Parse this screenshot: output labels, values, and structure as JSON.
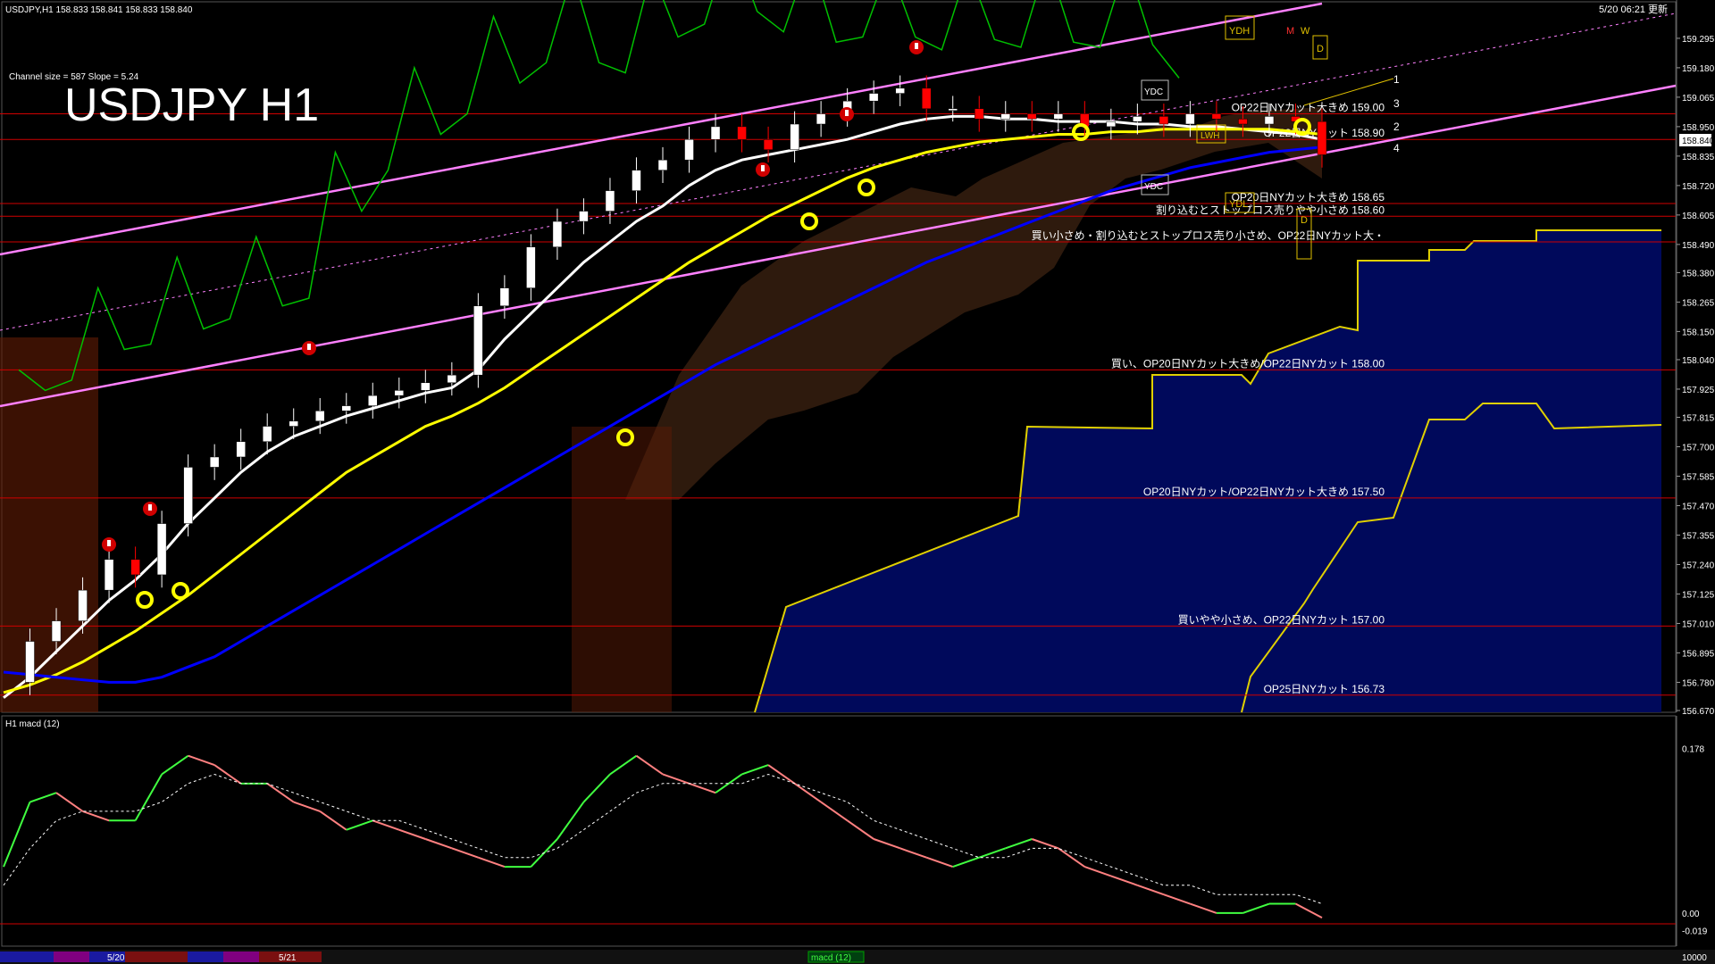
{
  "header": {
    "symbol_info": "USDJPY,H1  158.833 158.841 158.833 158.840",
    "datetime": "5/20 06:21 更新",
    "channel_info": "Channel size = 587 Slope = 5.24",
    "title": "USDJPY H1"
  },
  "colors": {
    "background": "#000000",
    "bull_candle": "#ffffff",
    "bear_candle": "#ff0000",
    "sma_short": "#ffffff",
    "sma_mid": "#ffff00",
    "sma_long": "#0000ff",
    "chikou": "#00c000",
    "channel": "#ff80ff",
    "level_line": "#d00000",
    "kumo_bull": "#ff8040",
    "kumo_bear": "#0000c0",
    "macd_up": "#40ff40",
    "macd_down": "#ff8080",
    "signal": "#ffffff"
  },
  "chart_data": [
    {
      "type": "line",
      "title": "USDJPY H1",
      "price_axis_ticks": [
        "159.295",
        "159.180",
        "159.065",
        "158.950",
        "158.835",
        "158.720",
        "158.605",
        "158.490",
        "158.380",
        "158.265",
        "158.150",
        "158.040",
        "157.925",
        "157.815",
        "157.700",
        "157.585",
        "157.470",
        "157.355",
        "157.240",
        "157.125",
        "157.010",
        "156.895",
        "156.780",
        "156.670"
      ],
      "ylim": [
        156.67,
        159.34
      ],
      "current_price": "158.840",
      "x": [
        0,
        4,
        8,
        12,
        16,
        20,
        24,
        28,
        32,
        36,
        40,
        44,
        48,
        52,
        56,
        60,
        64,
        68,
        72,
        76,
        80,
        84,
        88,
        92,
        96,
        100,
        104,
        108,
        112,
        116,
        120,
        124,
        128,
        132,
        136,
        140,
        144,
        148,
        152,
        156,
        160,
        164,
        168,
        172,
        176,
        180,
        184,
        188,
        192,
        196,
        200
      ],
      "series": [
        {
          "name": "close",
          "values": [
            156.78,
            156.94,
            157.02,
            157.14,
            157.26,
            157.2,
            157.4,
            157.62,
            157.66,
            157.72,
            157.78,
            157.8,
            157.84,
            157.86,
            157.9,
            157.92,
            157.95,
            157.98,
            158.25,
            158.32,
            158.48,
            158.58,
            158.62,
            158.7,
            158.78,
            158.82,
            158.9,
            158.95,
            158.9,
            158.86,
            158.96,
            159.0,
            159.05,
            159.08,
            159.1,
            159.02,
            159.02,
            158.98,
            159.0,
            158.98,
            159.0,
            158.95,
            158.97,
            158.99,
            158.96,
            159.0,
            158.98,
            158.96,
            158.99,
            158.97,
            158.84
          ]
        },
        {
          "name": "sma_short",
          "values": [
            156.72,
            156.8,
            156.9,
            157.0,
            157.1,
            157.18,
            157.28,
            157.4,
            157.5,
            157.6,
            157.68,
            157.74,
            157.78,
            157.82,
            157.85,
            157.88,
            157.91,
            157.93,
            158.0,
            158.12,
            158.22,
            158.32,
            158.42,
            158.5,
            158.58,
            158.64,
            158.72,
            158.78,
            158.82,
            158.84,
            158.86,
            158.88,
            158.9,
            158.93,
            158.96,
            158.98,
            158.99,
            158.99,
            158.98,
            158.98,
            158.97,
            158.97,
            158.97,
            158.96,
            158.96,
            158.95,
            158.95,
            158.94,
            158.93,
            158.92,
            158.9
          ]
        },
        {
          "name": "sma_mid",
          "values": [
            156.74,
            156.77,
            156.81,
            156.86,
            156.92,
            156.98,
            157.05,
            157.12,
            157.2,
            157.28,
            157.36,
            157.44,
            157.52,
            157.6,
            157.66,
            157.72,
            157.78,
            157.82,
            157.87,
            157.93,
            158.0,
            158.07,
            158.14,
            158.21,
            158.28,
            158.35,
            158.42,
            158.48,
            158.54,
            158.6,
            158.65,
            158.7,
            158.75,
            158.79,
            158.82,
            158.85,
            158.87,
            158.89,
            158.9,
            158.91,
            158.92,
            158.92,
            158.93,
            158.93,
            158.94,
            158.94,
            158.94,
            158.94,
            158.94,
            158.93,
            158.92
          ]
        },
        {
          "name": "sma_long",
          "values": [
            156.82,
            156.81,
            156.8,
            156.79,
            156.78,
            156.78,
            156.8,
            156.84,
            156.88,
            156.94,
            157.0,
            157.06,
            157.12,
            157.18,
            157.24,
            157.3,
            157.36,
            157.42,
            157.48,
            157.54,
            157.6,
            157.66,
            157.72,
            157.78,
            157.84,
            157.9,
            157.96,
            158.02,
            158.07,
            158.12,
            158.17,
            158.22,
            158.27,
            158.32,
            158.37,
            158.42,
            158.46,
            158.5,
            158.54,
            158.58,
            158.62,
            158.66,
            158.7,
            158.73,
            158.76,
            158.79,
            158.81,
            158.83,
            158.85,
            158.86,
            158.87
          ]
        }
      ]
    },
    {
      "type": "line",
      "title": "H1  macd (12)",
      "axis_ticks": [
        "0.178",
        "0.00",
        "-0.019"
      ],
      "ylim": [
        -0.03,
        0.19
      ],
      "x": [
        0,
        4,
        8,
        12,
        16,
        20,
        24,
        28,
        32,
        36,
        40,
        44,
        48,
        52,
        56,
        60,
        64,
        68,
        72,
        76,
        80,
        84,
        88,
        92,
        96,
        100,
        104,
        108,
        112,
        116,
        120,
        124,
        128,
        132,
        136,
        140,
        144,
        148,
        152,
        156,
        160,
        164,
        168,
        172,
        176,
        180,
        184,
        188,
        192,
        196,
        200
      ],
      "series": [
        {
          "name": "macd",
          "values": [
            0.05,
            0.12,
            0.13,
            0.11,
            0.1,
            0.1,
            0.15,
            0.17,
            0.16,
            0.14,
            0.14,
            0.12,
            0.11,
            0.09,
            0.1,
            0.09,
            0.08,
            0.07,
            0.06,
            0.05,
            0.05,
            0.08,
            0.12,
            0.15,
            0.17,
            0.15,
            0.14,
            0.13,
            0.15,
            0.16,
            0.14,
            0.12,
            0.1,
            0.08,
            0.07,
            0.06,
            0.05,
            0.06,
            0.07,
            0.08,
            0.07,
            0.05,
            0.04,
            0.03,
            0.02,
            0.01,
            0.0,
            0.0,
            0.01,
            0.01,
            -0.005
          ]
        },
        {
          "name": "signal",
          "values": [
            0.03,
            0.07,
            0.1,
            0.11,
            0.11,
            0.11,
            0.12,
            0.14,
            0.15,
            0.14,
            0.14,
            0.13,
            0.12,
            0.11,
            0.1,
            0.1,
            0.09,
            0.08,
            0.07,
            0.06,
            0.06,
            0.07,
            0.09,
            0.11,
            0.13,
            0.14,
            0.14,
            0.14,
            0.14,
            0.15,
            0.14,
            0.13,
            0.12,
            0.1,
            0.09,
            0.08,
            0.07,
            0.06,
            0.06,
            0.07,
            0.07,
            0.06,
            0.05,
            0.04,
            0.03,
            0.03,
            0.02,
            0.02,
            0.02,
            0.02,
            0.01
          ]
        }
      ]
    }
  ],
  "levels": [
    {
      "label": "OP22日NYカット大きめ 159.00",
      "price": 159.0
    },
    {
      "label": "OP22日NYカット 158.90",
      "price": 158.9
    },
    {
      "label": "OP20日NYカット大きめ 158.65",
      "price": 158.65
    },
    {
      "label": "割り込むとストップロス売りやや小さめ 158.60",
      "price": 158.6
    },
    {
      "label": "買い小さめ・割り込むとストップロス売り小さめ、OP22日NYカット大・",
      "price": 158.5
    },
    {
      "label": "買い、OP20日NYカット大きめ/OP22日NYカット 158.00",
      "price": 158.0
    },
    {
      "label": "OP20日NYカット/OP22日NYカット大きめ 157.50",
      "price": 157.5
    },
    {
      "label": "買いやや小さめ、OP22日NYカット 157.00",
      "price": 157.0
    },
    {
      "label": "OP25日NYカット 156.73",
      "price": 156.73
    }
  ],
  "markers": {
    "ydh": "YDH",
    "ydc": "YDC",
    "ydl": "YDL",
    "lwh": "LWH",
    "m": "M",
    "w": "W",
    "d": "D",
    "wave_1": "1",
    "wave_2": "2",
    "wave_3": "3",
    "wave_4": "4"
  },
  "footer": {
    "date_labels": [
      "5/20",
      "5/21"
    ],
    "indicator_tab": "macd (12)",
    "right_value": "10000"
  }
}
